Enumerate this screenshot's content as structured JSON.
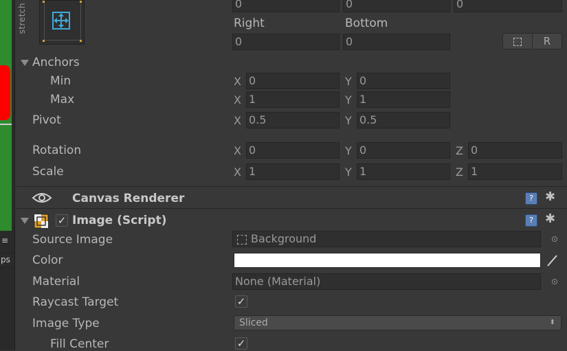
{
  "scene": {
    "menu_glyph": "≡",
    "ps_label": "ps"
  },
  "rect": {
    "stretch_label": "stretch",
    "top_values": [
      "0",
      "0",
      "0"
    ],
    "right_label": "Right",
    "bottom_label": "Bottom",
    "right_value": "0",
    "bottom_value": "0",
    "blueprint_button_glyph": "⬚",
    "raw_button_label": "R"
  },
  "anchors": {
    "label": "Anchors",
    "min_label": "Min",
    "max_label": "Max",
    "min_x": "0",
    "min_y": "0",
    "max_x": "1",
    "max_y": "1"
  },
  "pivot": {
    "label": "Pivot",
    "x": "0.5",
    "y": "0.5"
  },
  "rotation": {
    "label": "Rotation",
    "x": "0",
    "y": "0",
    "z": "0"
  },
  "scale": {
    "label": "Scale",
    "x": "1",
    "y": "1",
    "z": "1"
  },
  "axes": {
    "x": "X",
    "y": "Y",
    "z": "Z"
  },
  "canvas_renderer": {
    "title": "Canvas Renderer",
    "help": "?",
    "gear": "✱"
  },
  "image_script": {
    "title": "Image (Script)",
    "enabled_check": "✓",
    "help": "?",
    "gear": "✱",
    "source_image_label": "Source Image",
    "source_image_value": "Background",
    "color_label": "Color",
    "color_value": "#ffffff",
    "material_label": "Material",
    "material_value": "None (Material)",
    "raycast_label": "Raycast Target",
    "raycast_check": "✓",
    "image_type_label": "Image Type",
    "image_type_value": "Sliced",
    "fill_center_label": "Fill Center",
    "fill_center_check": "✓"
  },
  "colors": {
    "accent_blue": "#3fa9dc",
    "scene_green": "#2e8b2e",
    "scene_red": "#ff0000"
  }
}
